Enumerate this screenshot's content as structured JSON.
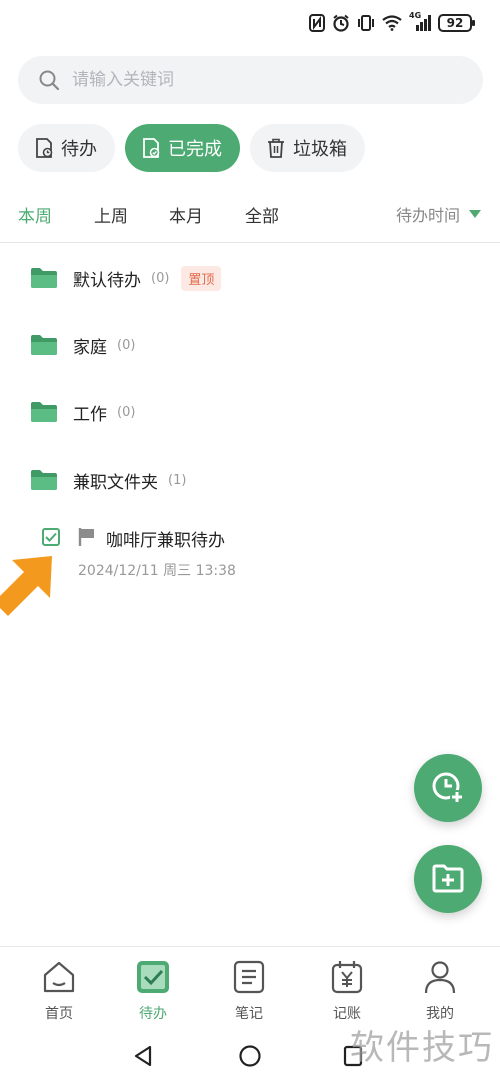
{
  "status_bar": {
    "icons": [
      "nfc-icon",
      "alarm-icon",
      "vibrate-icon",
      "wifi-icon",
      "signal-4g-icon"
    ],
    "network_label": "4G",
    "battery_level": "92"
  },
  "search": {
    "placeholder": "请输入关键词"
  },
  "categories": [
    {
      "label": "待办",
      "active": false,
      "icon": "todo-doc-icon"
    },
    {
      "label": "已完成",
      "active": true,
      "icon": "done-doc-icon"
    },
    {
      "label": "垃圾箱",
      "active": false,
      "icon": "trash-icon"
    }
  ],
  "period_tabs": [
    {
      "label": "本周",
      "active": true
    },
    {
      "label": "上周",
      "active": false
    },
    {
      "label": "本月",
      "active": false
    },
    {
      "label": "全部",
      "active": false
    }
  ],
  "sort": {
    "label": "待办时间"
  },
  "folders": [
    {
      "name": "默认待办",
      "count": "(0)",
      "pinned_label": "置顶"
    },
    {
      "name": "家庭",
      "count": "(0)"
    },
    {
      "name": "工作",
      "count": "(0)"
    },
    {
      "name": "兼职文件夹",
      "count": "(1)"
    }
  ],
  "task": {
    "title": "咖啡厅兼职待办",
    "time": "2024/12/11 周三 13:38",
    "checked": true
  },
  "bottom_nav": [
    {
      "label": "首页",
      "icon": "home-icon",
      "active": false
    },
    {
      "label": "待办",
      "icon": "todo-check-icon",
      "active": true
    },
    {
      "label": "笔记",
      "icon": "notes-icon",
      "active": false
    },
    {
      "label": "记账",
      "icon": "bookkeeping-icon",
      "active": false
    },
    {
      "label": "我的",
      "icon": "profile-icon",
      "active": false
    }
  ],
  "watermark": "软件技巧",
  "colors": {
    "accent": "#4caa72",
    "pin_text": "#e26b4d",
    "pin_bg": "#fde9e4",
    "arrow": "#f39a1e"
  }
}
